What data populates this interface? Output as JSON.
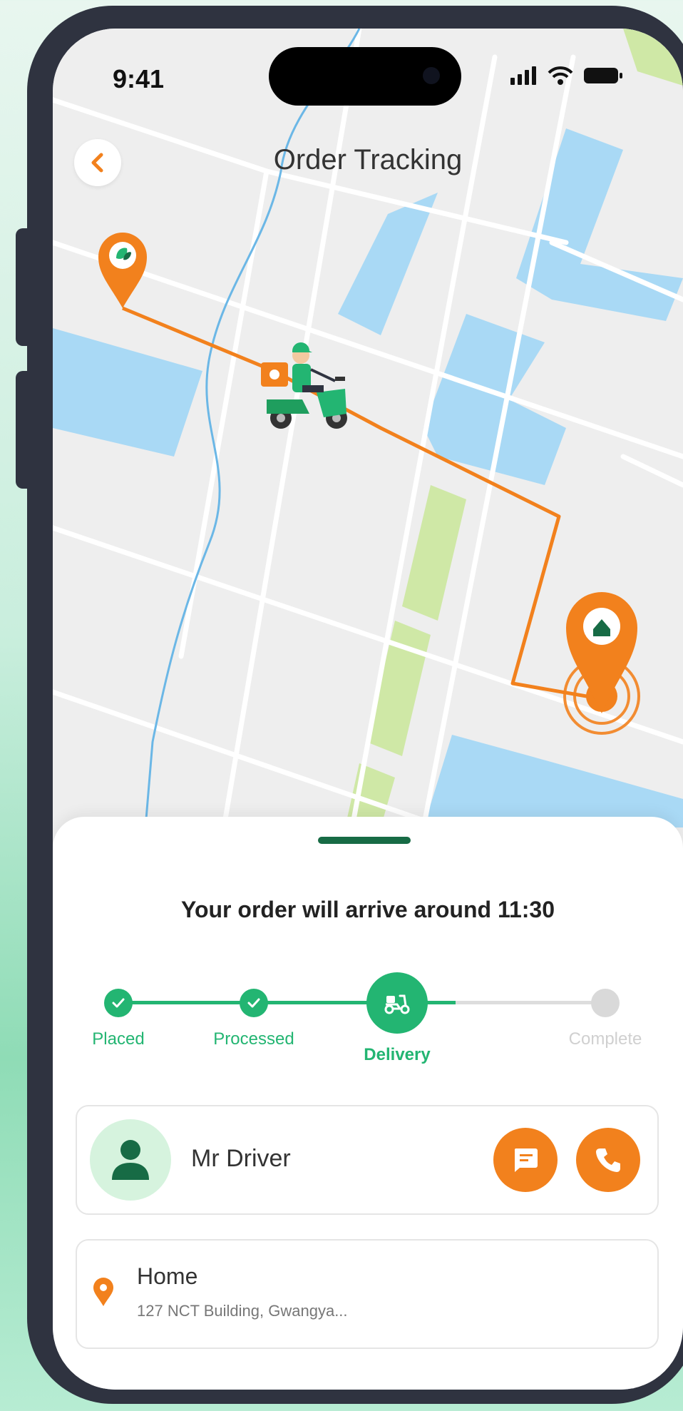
{
  "status_bar": {
    "time": "9:41"
  },
  "header": {
    "title": "Order Tracking"
  },
  "order": {
    "eta_text": "Your order will arrive around 11:30"
  },
  "steps": [
    {
      "label": "Placed",
      "state": "done"
    },
    {
      "label": "Processed",
      "state": "done"
    },
    {
      "label": "Delivery",
      "state": "active"
    },
    {
      "label": "Complete",
      "state": "pending"
    }
  ],
  "driver": {
    "name": "Mr Driver"
  },
  "address": {
    "label": "Home",
    "detail": "127 NCT Building, Gwangya..."
  },
  "colors": {
    "accent_orange": "#f2811d",
    "primary_green": "#23b572",
    "dark_green": "#176b45",
    "water_blue": "#a9d9f5",
    "park_green": "#cfe8a6"
  }
}
